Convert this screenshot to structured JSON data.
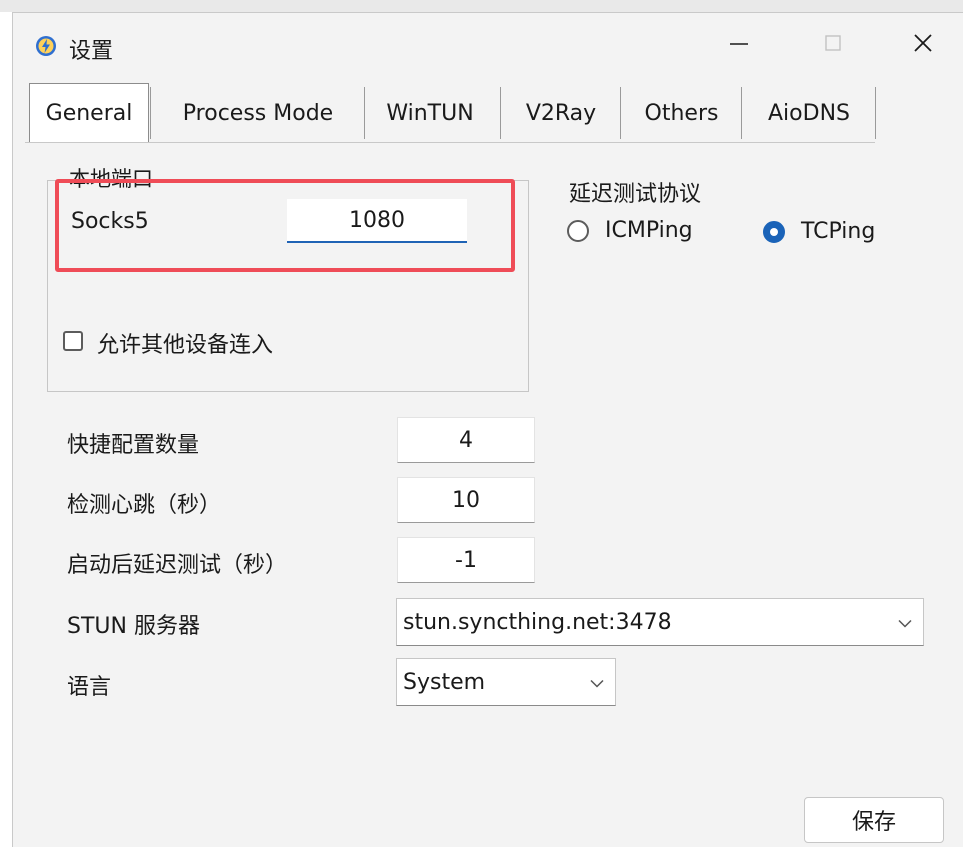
{
  "window": {
    "title": "设置",
    "icon": "app-lightning-icon",
    "minimize_icon": "minimize-icon",
    "maximize_icon": "maximize-icon",
    "close_icon": "close-icon"
  },
  "tabs": [
    {
      "label": "General",
      "active": true
    },
    {
      "label": "Process Mode",
      "active": false
    },
    {
      "label": "WinTUN",
      "active": false
    },
    {
      "label": "V2Ray",
      "active": false
    },
    {
      "label": "Others",
      "active": false
    },
    {
      "label": "AioDNS",
      "active": false
    }
  ],
  "local_port": {
    "group_title": "本地端口",
    "socks5_label": "Socks5",
    "socks5_value": "1080",
    "allow_devices_label": "允许其他设备连入",
    "allow_devices_checked": false
  },
  "latency_test": {
    "title": "延迟测试协议",
    "options": [
      {
        "label": "ICMPing",
        "selected": false
      },
      {
        "label": "TCPing",
        "selected": true
      }
    ]
  },
  "settings": {
    "quick_config_label": "快捷配置数量",
    "quick_config_value": "4",
    "heartbeat_label": "检测心跳（秒）",
    "heartbeat_value": "10",
    "startup_delay_label": "启动后延迟测试（秒）",
    "startup_delay_value": "-1",
    "stun_label": "STUN 服务器",
    "stun_value": "stun.syncthing.net:3478",
    "language_label": "语言",
    "language_value": "System"
  },
  "buttons": {
    "save": "保存"
  },
  "colors": {
    "highlight": "#ef4c57",
    "accent": "#1a63b8",
    "window_bg": "#f3f3f3"
  }
}
